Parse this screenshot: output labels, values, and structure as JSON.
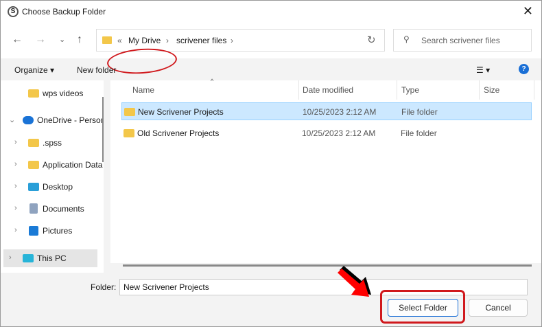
{
  "window": {
    "title": "Choose Backup Folder",
    "app_icon": "S"
  },
  "nav": {
    "back": "←",
    "forward": "→",
    "recent": "⌄",
    "up": "↑"
  },
  "address": {
    "overflow": "«",
    "segments": [
      "My Drive",
      "scrivener files"
    ],
    "sep": "›",
    "refresh": "↻"
  },
  "search": {
    "placeholder": "Search scrivener files"
  },
  "toolbar": {
    "organize": "Organize ▾",
    "new_folder": "New folder",
    "view": "☰ ▾",
    "help": "?"
  },
  "sidebar": {
    "items": [
      {
        "label": "wps videos",
        "chevron": ""
      },
      {
        "label": "OneDrive - Personal",
        "chevron": "⌄"
      },
      {
        "label": ".spss",
        "chevron": "›"
      },
      {
        "label": "Application Data",
        "chevron": "›"
      },
      {
        "label": "Desktop",
        "chevron": "›"
      },
      {
        "label": "Documents",
        "chevron": "›"
      },
      {
        "label": "Pictures",
        "chevron": "›"
      },
      {
        "label": "This PC",
        "chevron": "›"
      }
    ]
  },
  "columns": [
    "Name",
    "Date modified",
    "Type",
    "Size"
  ],
  "files": [
    {
      "name": "New Scrivener Projects",
      "date": "10/25/2023 2:12 AM",
      "type": "File folder",
      "selected": true
    },
    {
      "name": "Old Scrivener Projects",
      "date": "10/25/2023 2:12 AM",
      "type": "File folder",
      "selected": false
    }
  ],
  "footer": {
    "folder_label": "Folder:",
    "folder_value": "New Scrivener Projects",
    "select": "Select Folder",
    "cancel": "Cancel"
  },
  "colors": {
    "accent": "#1a6fd6",
    "annotation": "#d0191d",
    "selection": "#cce8ff"
  }
}
